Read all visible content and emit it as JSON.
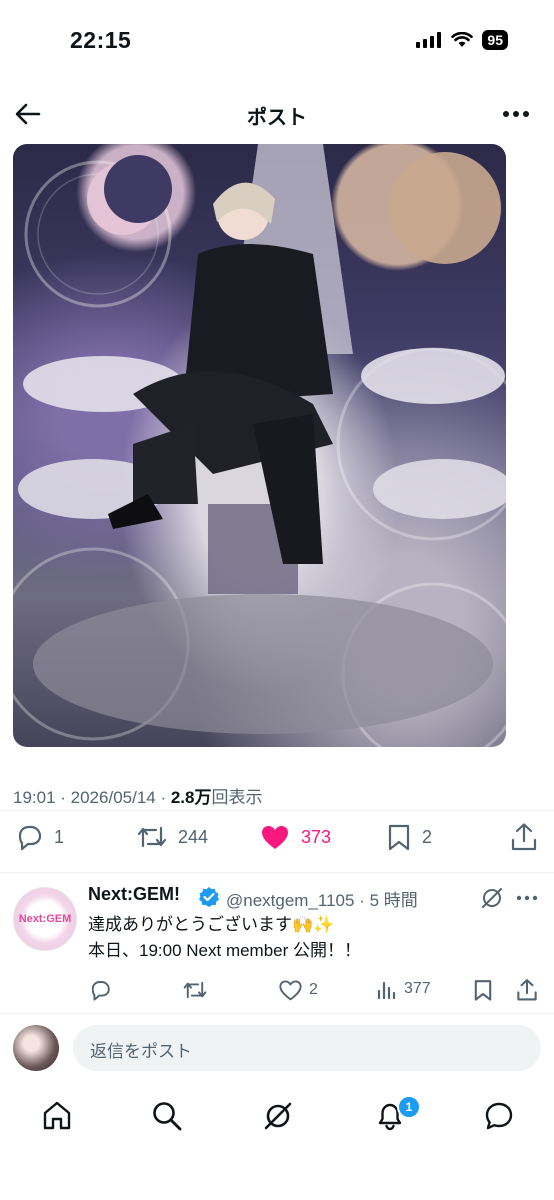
{
  "status_bar": {
    "time": "22:15",
    "battery": "95"
  },
  "header": {
    "title": "ポスト"
  },
  "post": {
    "timestamp": "19:01 · 2026/05/14 · ",
    "views_count": "2.8万",
    "views_label": "回表示",
    "actions": {
      "replies": "1",
      "reposts": "244",
      "likes": "373",
      "bookmarks": "2"
    },
    "liked": true
  },
  "reply": {
    "avatar_text": "Next:GEM",
    "name": "Next:GEM!",
    "handle_time": "@nextgem_1105 · 5 時間",
    "line1": "達成ありがとうございます🙌✨",
    "line2": "本日、19:00 Next member 公開！！",
    "actions": {
      "likes": "2",
      "views": "377"
    }
  },
  "compose": {
    "placeholder": "返信をポスト"
  },
  "tabbar": {
    "notification_badge": "1"
  },
  "colors": {
    "like": "#f91880",
    "verified": "#1d9bf0",
    "muted": "#536471"
  }
}
